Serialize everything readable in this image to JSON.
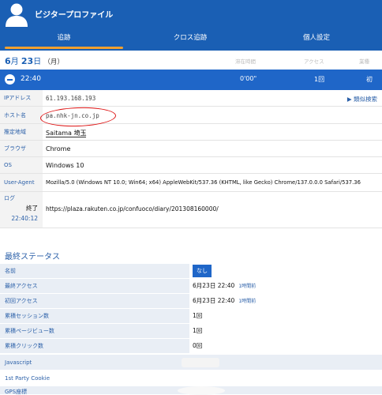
{
  "header": {
    "title": "ビジタープロファイル",
    "avatar_icon": "user-avatar-icon",
    "tabs": [
      {
        "label": "追跡",
        "active": true
      },
      {
        "label": "クロス追跡",
        "active": false
      },
      {
        "label": "個人設定",
        "active": false
      }
    ],
    "accent_color": "#1a5fb4",
    "tab_indicator_color": "#f0a030"
  },
  "date_row": {
    "month": "6",
    "month_suffix": "月",
    "day": "23",
    "day_suffix": "日",
    "weekday": "（月）",
    "col_stay": "滞在時間",
    "col_access": "アクセス",
    "col_first": "業種"
  },
  "visit": {
    "time": "22:40",
    "duration": "0'00\"",
    "count": "1回",
    "first": "初"
  },
  "details": {
    "ip_label": "IPアドレス",
    "ip_value": "61.193.168.193",
    "similar_search": "▶ 類似検索",
    "host_label": "ホスト名",
    "host_value": "pa.nhk-jn.co.jp",
    "region_label": "推定地域",
    "region_value": "Saitama 埼玉",
    "browser_label": "ブラウザ",
    "browser_value": "Chrome",
    "os_label": "OS",
    "os_value": "Windows 10",
    "ua_label": "User-Agent",
    "ua_value": "Mozilla/5.0 (Windows NT 10.0; Win64; x64) AppleWebKit/537.36 (KHTML, like Gecko) Chrome/137.0.0.0 Safari/537.36",
    "log_label": "ログ",
    "log_end_label": "終了",
    "log_end_time": "22:40:12",
    "log_url": "https://plaza.rakuten.co.jp/confuoco/diary/201308160000/"
  },
  "status": {
    "section_title": "最終ステータス",
    "name_label": "名前",
    "name_value": "なし",
    "last_access_label": "最終アクセス",
    "last_access_value": "6月23日 22:40",
    "last_access_ago": "1時間前",
    "first_access_label": "初回アクセス",
    "first_access_value": "6月23日 22:40",
    "first_access_ago": "1時間前",
    "sessions_label": "累積セッション数",
    "sessions_value": "1回",
    "pageviews_label": "累積ページビュー数",
    "pageviews_value": "1回",
    "clicks_label": "累積クリック数",
    "clicks_value": "0回"
  },
  "environment": {
    "javascript_label": "Javascript",
    "cookie_label": "1st Party Cookie",
    "gps_label": "GPS座標"
  }
}
